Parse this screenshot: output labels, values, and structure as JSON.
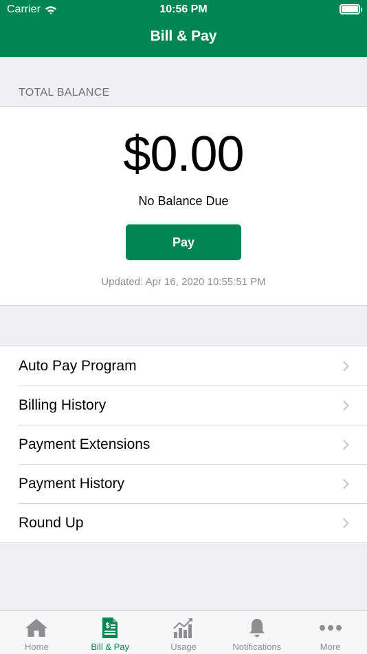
{
  "status_bar": {
    "carrier": "Carrier",
    "time": "10:56 PM"
  },
  "header": {
    "title": "Bill & Pay"
  },
  "balance": {
    "section_label": "TOTAL BALANCE",
    "amount": "$0.00",
    "status": "No Balance Due",
    "pay_label": "Pay",
    "updated": "Updated: Apr 16, 2020 10:55:51 PM"
  },
  "menu": {
    "items": [
      {
        "label": "Auto Pay Program"
      },
      {
        "label": "Billing History"
      },
      {
        "label": "Payment Extensions"
      },
      {
        "label": "Payment History"
      },
      {
        "label": "Round Up"
      }
    ]
  },
  "tabs": [
    {
      "label": "Home",
      "icon": "home-icon",
      "active": false
    },
    {
      "label": "Bill & Pay",
      "icon": "bill-icon",
      "active": true
    },
    {
      "label": "Usage",
      "icon": "usage-chart-icon",
      "active": false
    },
    {
      "label": "Notifications",
      "icon": "bell-icon",
      "active": false
    },
    {
      "label": "More",
      "icon": "more-dots-icon",
      "active": false
    }
  ],
  "colors": {
    "brand": "#008556",
    "inactive": "#8e8e93",
    "background": "#efeff4"
  }
}
